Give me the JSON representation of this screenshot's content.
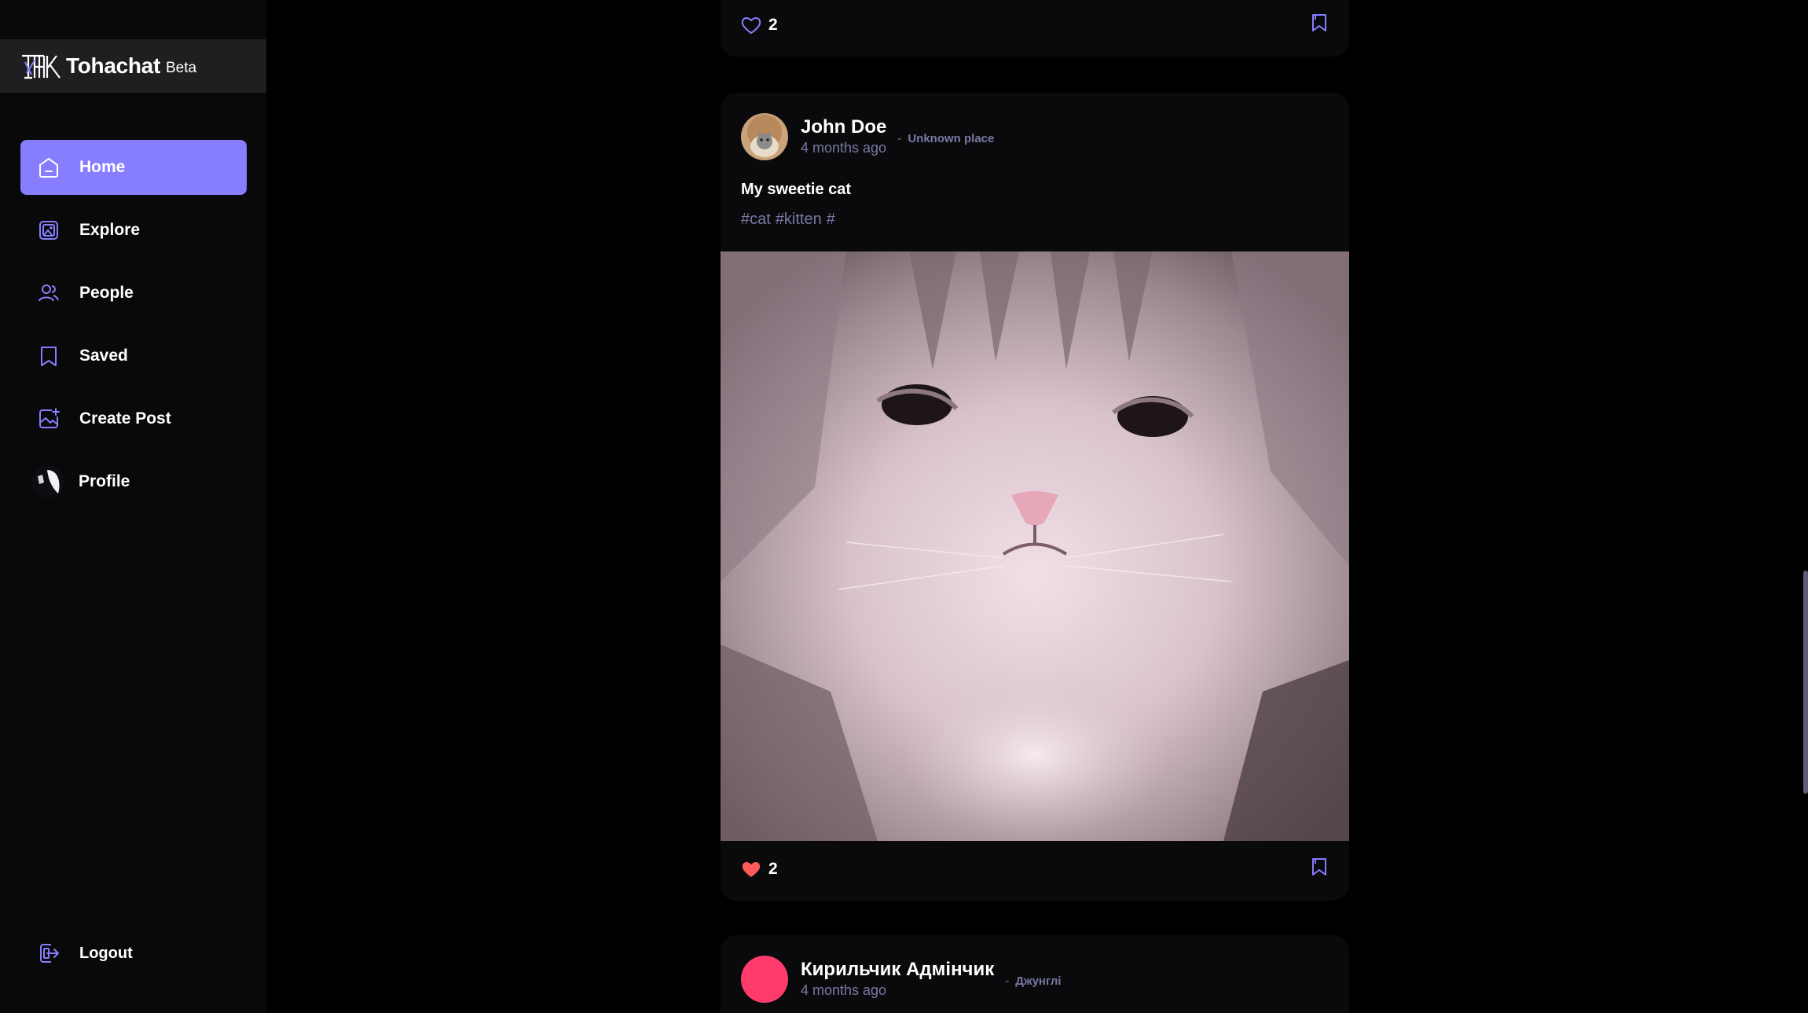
{
  "brand": {
    "name": "Tohachat",
    "badge": "Beta"
  },
  "nav": {
    "items": [
      {
        "label": "Home",
        "icon": "home-icon",
        "active": true
      },
      {
        "label": "Explore",
        "icon": "gallery-icon"
      },
      {
        "label": "People",
        "icon": "people-icon"
      },
      {
        "label": "Saved",
        "icon": "bookmark-icon"
      },
      {
        "label": "Create Post",
        "icon": "image-add-icon"
      },
      {
        "label": "Profile",
        "icon": "avatar"
      }
    ],
    "logout": "Logout"
  },
  "colors": {
    "accent": "#877eff",
    "muted": "#7878a3",
    "card": "#0a0a0c",
    "sidebar": "#09090a",
    "like": "#ff5a5a",
    "avatar_pink": "#ff3b6b"
  },
  "feed": {
    "prev_post": {
      "likes": "2",
      "liked": false
    },
    "post": {
      "author": "John Doe",
      "place_sep": "-",
      "place": "Unknown place",
      "time": "4 months ago",
      "caption": "My sweetie cat",
      "tags": [
        "#cat",
        "#kitten",
        "#"
      ],
      "likes": "2",
      "liked": true
    },
    "next_post": {
      "author": "Кирильчик Адмінчик",
      "place_sep": "-",
      "place": "Джунглі",
      "time": "4 months ago"
    }
  }
}
